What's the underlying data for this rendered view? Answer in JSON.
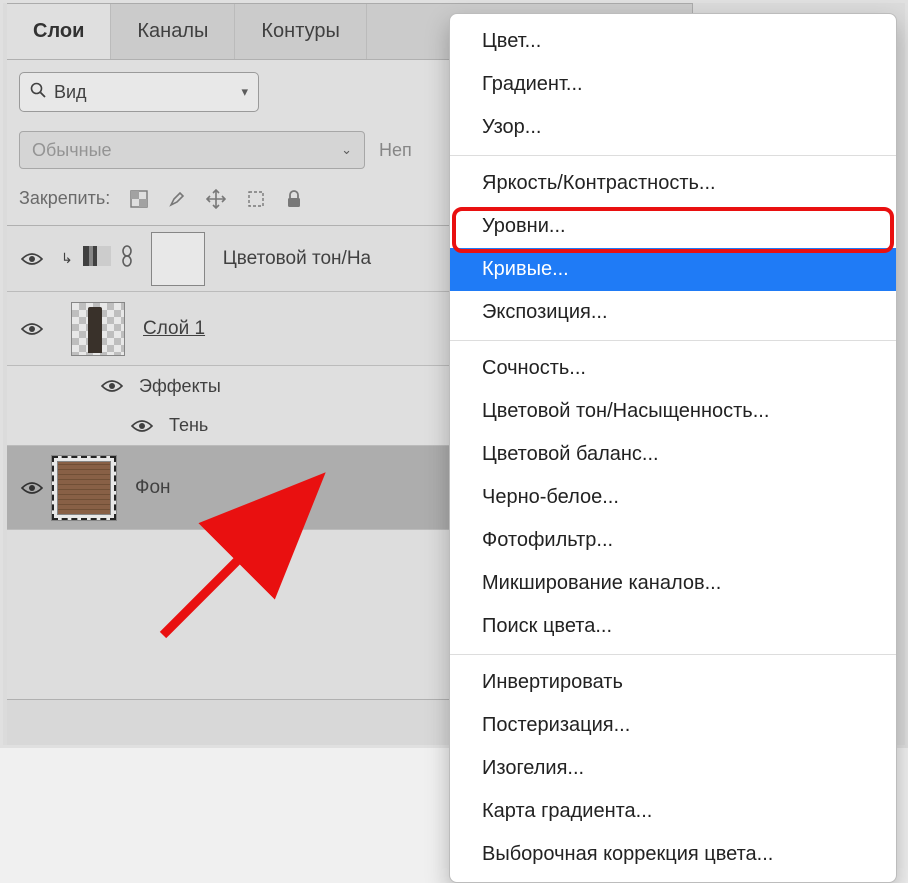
{
  "tabs": [
    "Слои",
    "Каналы",
    "Контуры"
  ],
  "activeTab": 0,
  "searchCombo": {
    "label": "Вид"
  },
  "blendRow": {
    "mode": "Обычные",
    "opacityLabel": "Неп"
  },
  "lockRow": {
    "label": "Закрепить:"
  },
  "layers": {
    "adjustment": {
      "name": "Цветовой тон/На"
    },
    "layer1": {
      "name": "Слой 1",
      "effectsLabel": "Эффекты",
      "shadowLabel": "Тень"
    },
    "bg": {
      "name": "Фон"
    }
  },
  "menu": {
    "groups": [
      [
        "Цвет...",
        "Градиент...",
        "Узор..."
      ],
      [
        "Яркость/Контрастность...",
        "Уровни...",
        "Кривые...",
        "Экспозиция..."
      ],
      [
        "Сочность...",
        "Цветовой тон/Насыщенность...",
        "Цветовой баланс...",
        "Черно-белое...",
        "Фотофильтр...",
        "Микширование каналов...",
        "Поиск цвета..."
      ],
      [
        "Инвертировать",
        "Постеризация...",
        "Изогелия...",
        "Карта градиента...",
        "Выборочная коррекция цвета..."
      ]
    ],
    "selected": "Кривые..."
  }
}
